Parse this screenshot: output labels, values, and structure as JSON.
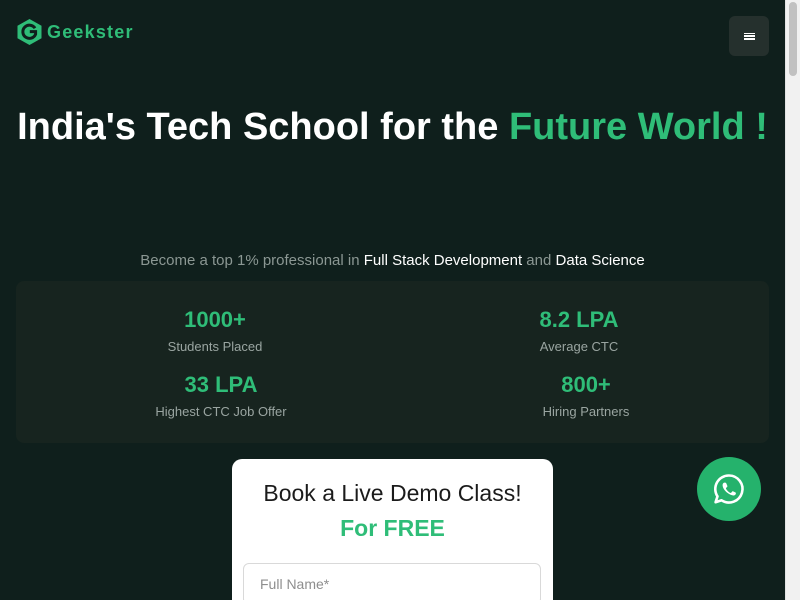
{
  "brand": {
    "name": "Geekster"
  },
  "header": {
    "menu_icon": "hamburger-menu-icon"
  },
  "hero": {
    "title_main": "India's Tech School for the ",
    "title_accent": "Future World !",
    "sub_prefix": "Become a top 1% professional in ",
    "sub_hl1": "Full Stack Development",
    "sub_mid": " and ",
    "sub_hl2": "Data Science"
  },
  "stats": [
    {
      "value": "1000+",
      "label": "Students Placed"
    },
    {
      "value": "8.2 LPA",
      "label": "Average CTC"
    },
    {
      "value": "33 LPA",
      "label": "Highest CTC Job Offer"
    },
    {
      "value": "800+",
      "label": "Hiring Partners"
    }
  ],
  "form": {
    "title": "Book a Live Demo Class!",
    "subtitle": "For FREE",
    "name_placeholder": "Full Name*"
  },
  "colors": {
    "background": "#0f1f1c",
    "accent": "#2fbd78",
    "stats_panel": "#17241f",
    "whatsapp": "#25b26c"
  },
  "icons": {
    "whatsapp": "whatsapp-icon",
    "logo": "geekster-logo-icon"
  }
}
